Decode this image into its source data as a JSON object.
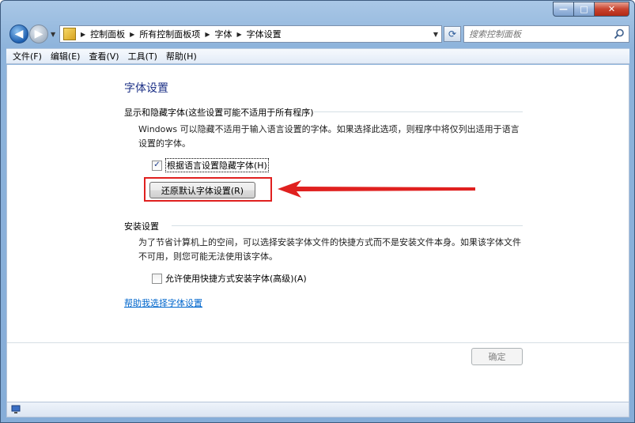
{
  "window": {
    "caption_buttons": {
      "minimize": "—",
      "maximize": "□",
      "close": "✕"
    }
  },
  "nav": {
    "back_icon": "back-arrow-icon",
    "forward_icon": "forward-arrow-icon"
  },
  "address": {
    "breadcrumbs": [
      "控制面板",
      "所有控制面板项",
      "字体",
      "字体设置"
    ]
  },
  "search": {
    "placeholder": "搜索控制面板"
  },
  "menu": {
    "items": [
      "文件(F)",
      "编辑(E)",
      "查看(V)",
      "工具(T)",
      "帮助(H)"
    ]
  },
  "page": {
    "title": "字体设置",
    "section1": {
      "title": "显示和隐藏字体(这些设置可能不适用于所有程序)",
      "description": "Windows 可以隐藏不适用于输入语言设置的字体。如果选择此选项，则程序中将仅列出适用于语言设置的字体。",
      "checkbox_label": "根据语言设置隐藏字体(H)",
      "checkbox_checked": true,
      "restore_button": "还原默认字体设置(R)"
    },
    "section2": {
      "title": "安装设置",
      "description": "为了节省计算机上的空间，可以选择安装字体文件的快捷方式而不是安装文件本身。如果该字体文件不可用，则您可能无法使用该字体。",
      "checkbox_label": "允许使用快捷方式安装字体(高级)(A)",
      "checkbox_checked": false
    },
    "help_link": "帮助我选择字体设置",
    "ok_button": "确定"
  },
  "colors": {
    "title_blue": "#1e3287",
    "link_blue": "#0066cc",
    "highlight_red": "#e0201f"
  }
}
